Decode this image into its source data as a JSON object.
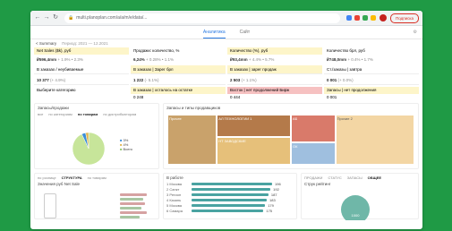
{
  "browser": {
    "url": "multi.planoplan.com/a/a/m/e/data/...",
    "pill_label": "Подписка"
  },
  "app": {
    "tab_active": "Аналитика",
    "tab_other": "Сайт"
  },
  "summary": {
    "title": "< Summary",
    "meta": "Период: 2021 — 12.2021"
  },
  "top_tiles": [
    {
      "label": "Net Sales ($k), руб",
      "value": "₽596,4mm",
      "sub": "+ 1.9% • 2.3%"
    },
    {
      "label": "Продажи: количество, %",
      "value": "6,24%",
      "sub": "+ 0.28% • 1.1%"
    },
    {
      "label": "Количество (%), руб",
      "value": "₽93,4mm",
      "sub": "+ 4.4% • 5.7%"
    },
    {
      "label": "Количество брл, руб",
      "value": "₽748,0mm",
      "sub": "+ 0.4% • 1.7%"
    }
  ],
  "kpis": [
    {
      "label": "В заказах / неубиваемые",
      "value": "10 377",
      "sub": "(+ 4.9%)"
    },
    {
      "label": "В заказах | Зарег брл",
      "value": "1 222",
      "sub": "(- 5.1%)"
    },
    {
      "label": "В заказах | зарег продаж",
      "value": "2 503",
      "sub": "(+ 1.1%)"
    },
    {
      "label": "Ст./заказы | завтра",
      "value": "0 001",
      "sub": "(+ 0.0%)"
    }
  ],
  "tabbar": [
    {
      "label": "Выберите категорию",
      "tone": "plain"
    },
    {
      "label": "В заказах | осталось на остатке",
      "tone": "yellow",
      "value": "0 248"
    },
    {
      "label": "Восток | нет продолжений Бирж",
      "tone": "red",
      "value": "0 444"
    },
    {
      "label": "Запасы | нет продолжения",
      "tone": "yellow",
      "value": "0 001"
    }
  ],
  "pie_panel": {
    "title": "Запасы/продажи",
    "tabs": [
      "все",
      "по категориям",
      "по товарам",
      "по дистрибьюторам"
    ],
    "legend": [
      {
        "label": "3%",
        "color": "#3a8ed8"
      },
      {
        "label": "4%",
        "color": "#e1b64d"
      },
      {
        "label": "Всего",
        "color": "#8cc66b"
      }
    ],
    "slices": [
      {
        "label": "Продажи",
        "value": 93,
        "color": "#c7e59a"
      },
      {
        "label": "Прочее",
        "value": 4,
        "color": "#3a8ed8"
      },
      {
        "label": "Остаток",
        "value": 3,
        "color": "#e1b64d"
      }
    ]
  },
  "treemap_panel": {
    "title": "Запасы и типы продавщиков",
    "blocks": [
      {
        "label": "Прочее",
        "color": "#c9a26b"
      },
      {
        "label": "АЛ ТЕХНОЛОГИИ 1",
        "color": "#b47a4a"
      },
      {
        "label": "НТ ЗАВОДСКИЕ",
        "color": "#e6c07a"
      },
      {
        "label": "АБ",
        "color": "#d97a6a"
      },
      {
        "label": "ОК",
        "color": "#9fbfdf"
      },
      {
        "label": "Прочие 2",
        "color": "#f3d6a4"
      }
    ]
  },
  "bottom": {
    "left_title": "Значения руб Net Sale",
    "left_tabs": [
      "по рознице",
      "СТРУКТУРА",
      "по товарам"
    ],
    "mid_title": "В работе",
    "mid_rows": [
      {
        "label": "1 Москва",
        "value": "196"
      },
      {
        "label": "2 Санкт",
        "value": "192"
      },
      {
        "label": "3 Регион",
        "value": "187"
      },
      {
        "label": "4 Казань",
        "value": "183"
      },
      {
        "label": "5 Москва",
        "value": "179"
      },
      {
        "label": "6 Самара",
        "value": "175"
      }
    ],
    "right_title": "Струк рейтинг",
    "right_tabs": [
      "ПРОДАЖИ",
      "СТАТУС",
      "ЗАПАСЫ",
      "ОБЩЕЕ"
    ],
    "right_value": "1000"
  }
}
